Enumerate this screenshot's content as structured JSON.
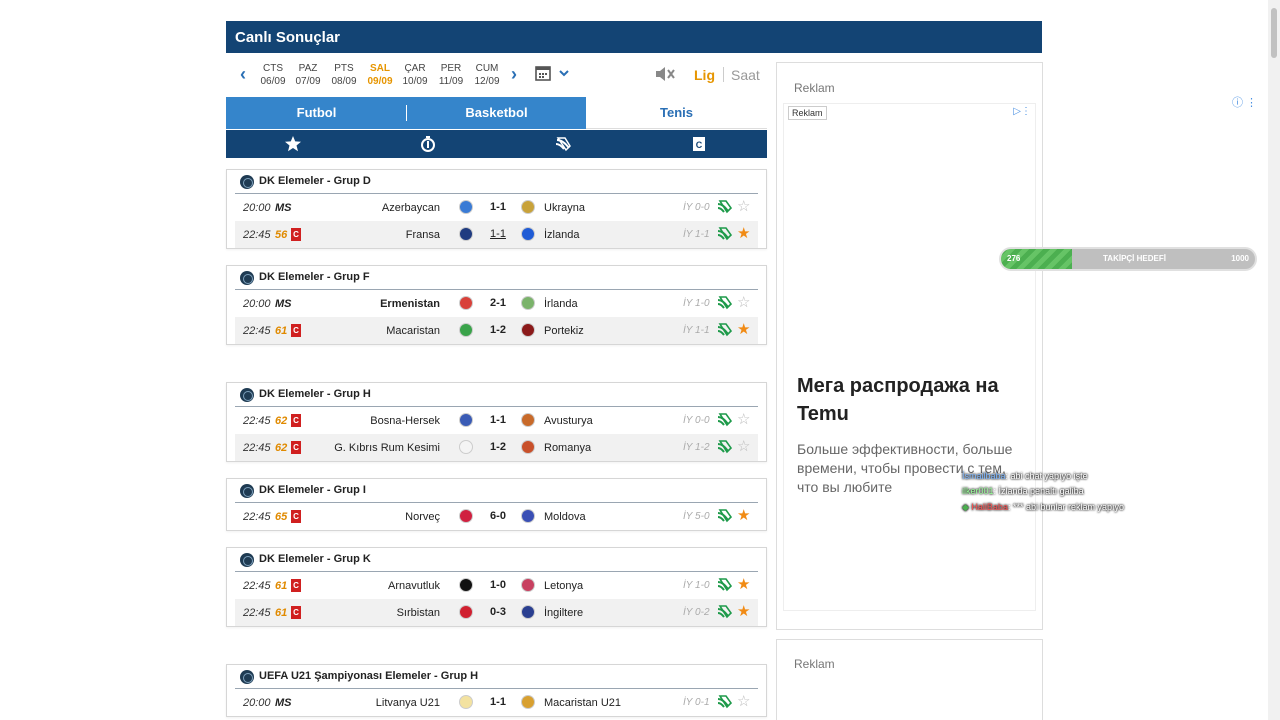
{
  "header": {
    "title": "Canlı Sonuçlar"
  },
  "dates": [
    {
      "day": "CTS",
      "date": "06/09",
      "active": false
    },
    {
      "day": "PAZ",
      "date": "07/09",
      "active": false
    },
    {
      "day": "PTS",
      "date": "08/09",
      "active": false
    },
    {
      "day": "SAL",
      "date": "09/09",
      "active": true
    },
    {
      "day": "ÇAR",
      "date": "10/09",
      "active": false
    },
    {
      "day": "PER",
      "date": "11/09",
      "active": false
    },
    {
      "day": "CUM",
      "date": "12/09",
      "active": false
    }
  ],
  "sort": {
    "lig": "Lig",
    "saat": "Saat"
  },
  "tabs": {
    "futbol": "Futbol",
    "basketbol": "Basketbol",
    "tenis": "Tenis"
  },
  "filter_icons": [
    "star-icon",
    "stopwatch-icon",
    "tv-icon",
    "card-icon"
  ],
  "leagues": [
    {
      "name": "DK Elemeler - Grup D",
      "matches": [
        {
          "time": "20:00",
          "status": "MS",
          "home": "Azerbaycan",
          "score": "1-1",
          "away": "Ukrayna",
          "ht": "İY 0-0",
          "fav": false
        },
        {
          "time": "22:45",
          "minute": "56",
          "home": "Fransa",
          "score": "1-1",
          "away": "İzlanda",
          "ht": "İY 1-1",
          "fav": true
        }
      ]
    },
    {
      "name": "DK Elemeler - Grup F",
      "matches": [
        {
          "time": "20:00",
          "status": "MS",
          "home": "Ermenistan",
          "score": "2-1",
          "away": "İrlanda",
          "ht": "İY 1-0",
          "fav": false
        },
        {
          "time": "22:45",
          "minute": "61",
          "home": "Macaristan",
          "score": "1-2",
          "away": "Portekiz",
          "ht": "İY 1-1",
          "fav": true
        }
      ]
    },
    {
      "name": "DK Elemeler - Grup H",
      "matches": [
        {
          "time": "22:45",
          "minute": "62",
          "home": "Bosna-Hersek",
          "score": "1-1",
          "away": "Avusturya",
          "ht": "İY 0-0",
          "fav": false
        },
        {
          "time": "22:45",
          "minute": "62",
          "home": "G. Kıbrıs Rum Kesimi",
          "score": "1-2",
          "away": "Romanya",
          "ht": "İY 1-2",
          "fav": false
        }
      ]
    },
    {
      "name": "DK Elemeler - Grup I",
      "matches": [
        {
          "time": "22:45",
          "minute": "65",
          "home": "Norveç",
          "score": "6-0",
          "away": "Moldova",
          "ht": "İY 5-0",
          "fav": true
        }
      ]
    },
    {
      "name": "DK Elemeler - Grup K",
      "matches": [
        {
          "time": "22:45",
          "minute": "61",
          "home": "Arnavutluk",
          "score": "1-0",
          "away": "Letonya",
          "ht": "İY 1-0",
          "fav": true
        },
        {
          "time": "22:45",
          "minute": "61",
          "home": "Sırbistan",
          "score": "0-3",
          "away": "İngiltere",
          "ht": "İY 0-2",
          "fav": true
        }
      ]
    },
    {
      "name": "UEFA U21 Şampiyonası Elemeler - Grup H",
      "matches": [
        {
          "time": "20:00",
          "status": "MS",
          "home": "Litvanya U21",
          "score": "1-1",
          "away": "Macaristan U21",
          "ht": "İY 0-1",
          "fav": false
        }
      ]
    }
  ],
  "ad": {
    "label": "Reklam",
    "badge": "Reklam",
    "title": "Мега распродажа на Temu",
    "text": "Больше эффективности, больше времени, чтобы провести с тем, что вы любите",
    "label2": "Reklam"
  },
  "overlay": {
    "goal_current": "276",
    "goal_label": "TAKİPÇİ HEDEFİ",
    "goal_target": "1000",
    "goal_progress": 0.28,
    "chat": [
      {
        "user": "İsmailbaba",
        "msg": ": abi chat yapıyo işte"
      },
      {
        "user": "ilker001",
        "msg": ": İzlanda penaltı galiba"
      },
      {
        "user": "HaliBaba",
        "msg": ": *** abi bunlar reklam yapıyo"
      }
    ]
  },
  "colors": {
    "brand": "#134474",
    "tab_blue": "#3585cb",
    "accent": "#e69500",
    "star": "#f18b15"
  }
}
